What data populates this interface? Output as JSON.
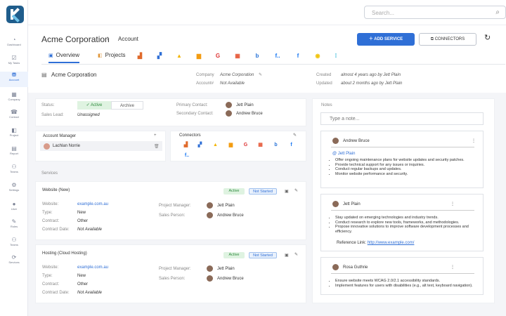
{
  "sidebar": {
    "items": [
      {
        "label": "Dashboard",
        "icon": "dashboard-icon",
        "glyph": "◔"
      },
      {
        "label": "My Tasks",
        "icon": "tasks-icon",
        "glyph": "☑"
      },
      {
        "label": "Account",
        "icon": "account-icon",
        "glyph": "⛃"
      },
      {
        "label": "Company",
        "icon": "company-icon",
        "glyph": "▦"
      },
      {
        "label": "Contact",
        "icon": "contact-icon",
        "glyph": "☎"
      },
      {
        "label": "Project",
        "icon": "project-icon",
        "glyph": "◧"
      },
      {
        "label": "Report",
        "icon": "report-icon",
        "glyph": "▤"
      },
      {
        "label": "Teams",
        "icon": "teams-icon",
        "glyph": "⚇"
      },
      {
        "label": "Settings",
        "icon": "settings-icon",
        "glyph": "⚙"
      },
      {
        "label": "User",
        "icon": "user-icon",
        "glyph": "●"
      },
      {
        "label": "Roles",
        "icon": "roles-icon",
        "glyph": "✎"
      },
      {
        "label": "Teams",
        "icon": "teams-icon",
        "glyph": "⚇"
      },
      {
        "label": "Services",
        "icon": "services-icon",
        "glyph": "⟳"
      }
    ]
  },
  "search": {
    "placeholder": "Search..."
  },
  "header": {
    "title": "Acme Corporation",
    "crumb": "Account",
    "add_service": "ADD SERVICE",
    "connectors": "CONNECTORS"
  },
  "tabs": {
    "overview": "Overview",
    "projects": "Projects"
  },
  "account_meta": {
    "name": "Acme Corporation",
    "company_label": "Company",
    "company_value": "Acme Corporation",
    "account_no_label": "Account#",
    "account_no_value": "Not Available",
    "created_label": "Created",
    "created_value": "almost 4 years ago by Jett Plain",
    "updated_label": "Updated",
    "updated_value": "about 2 months ago by Jett Plain"
  },
  "status": {
    "status_label": "Status:",
    "active": "Active",
    "archive": "Archive",
    "sales_lead_label": "Sales Lead:",
    "sales_lead_value": "Unassigned",
    "primary_contact_label": "Primary Contact:",
    "primary_contact_value": "Jett Plain",
    "secondary_contact_label": "Secondary Contact:",
    "secondary_contact_value": "Andrew Bruce"
  },
  "account_manager": {
    "title": "Account Manager",
    "name": "Lachlan Norrie"
  },
  "connectors": {
    "title": "Connectors"
  },
  "services": {
    "title": "Services",
    "items": [
      {
        "name": "Website (New)",
        "status": "Active",
        "progress": "Not Started",
        "website_label": "Website:",
        "website": "example.com.au",
        "type_label": "Type:",
        "type": "New",
        "contract_label": "Contract:",
        "contract": "Other",
        "contract_date_label": "Contract Date:",
        "contract_date": "Not Available",
        "pm_label": "Project Manager:",
        "pm": "Jett Plain",
        "sp_label": "Sales Person:",
        "sp": "Andrew Bruce"
      },
      {
        "name": "Hosting (Cloud Hosting)",
        "status": "Active",
        "progress": "Not Started",
        "website_label": "Website:",
        "website": "example.com.au",
        "type_label": "Type:",
        "type": "New",
        "contract_label": "Contract:",
        "contract": "Other",
        "contract_date_label": "Contract Date:",
        "contract_date": "Not Available",
        "pm_label": "Project Manager:",
        "pm": "Jett Plain",
        "sp_label": "Sales Person:",
        "sp": "Andrew Bruce"
      }
    ]
  },
  "notes": {
    "title": "Notes",
    "placeholder": "Type a note...",
    "items": [
      {
        "author": "Andrew Bruce",
        "mention": "@ Jett Plain",
        "bullets": [
          "Offer ongoing maintenance plans for website updates and security patches.",
          "Provide technical support for any issues or inquiries.",
          "Conduct regular backups and updates.",
          "Monitor website performance and security."
        ]
      },
      {
        "author": "Jett Plain",
        "bullets": [
          "Stay updated on emerging technologies and industry trends.",
          "Conduct research to explore new tools, frameworks, and methodologies.",
          "Propose innovative solutions to improve software development processes and efficiency."
        ],
        "ref_label": "Reference Link:",
        "ref_link": "http://www.example.com/"
      },
      {
        "author": "Rosa Guthrie",
        "bullets": [
          "Ensure website meets WCAG 2.0/2.1 accessibility standards.",
          "Implement features for users with disabilities (e.g., alt text, keyboard navigation)."
        ]
      }
    ]
  },
  "colors": {
    "accent": "#2f6fd6",
    "active_green": "#2e8b3d"
  }
}
